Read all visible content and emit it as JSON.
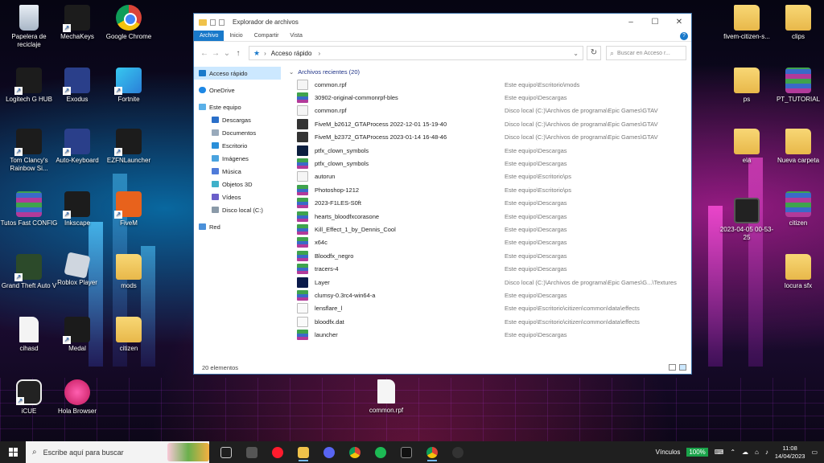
{
  "desktop": {
    "left_icons": [
      {
        "label": "Papelera de reciclaje",
        "icon": "recycle-bin-icon"
      },
      {
        "label": "MechaKeys",
        "icon": "mechakeys-icon"
      },
      {
        "label": "Google Chrome",
        "icon": "chrome-icon"
      },
      {
        "label": "Logitech G HUB",
        "icon": "logitech-icon"
      },
      {
        "label": "Exodus",
        "icon": "exodus-icon"
      },
      {
        "label": "Fortnite",
        "icon": "fortnite-icon"
      },
      {
        "label": "Tom Clancy's Rainbow Si...",
        "icon": "rainbow-six-icon"
      },
      {
        "label": "Auto-Keyboard",
        "icon": "keyboard-icon"
      },
      {
        "label": "EZFNLauncher",
        "icon": "launcher-icon"
      },
      {
        "label": "Tutos Fast CONFIG",
        "icon": "winrar-icon"
      },
      {
        "label": "Inkscape",
        "icon": "inkscape-icon"
      },
      {
        "label": "FiveM",
        "icon": "fivem-icon"
      },
      {
        "label": "Grand Theft Auto V",
        "icon": "gta-icon"
      },
      {
        "label": "Roblox Player",
        "icon": "roblox-icon"
      },
      {
        "label": "mods",
        "icon": "folder-icon"
      },
      {
        "label": "cihasd",
        "icon": "sound-icon"
      },
      {
        "label": "Medal",
        "icon": "medal-icon"
      },
      {
        "label": "citizen",
        "icon": "folder-icon"
      },
      {
        "label": "iCUE",
        "icon": "icue-icon"
      },
      {
        "label": "Hola Browser",
        "icon": "hola-icon"
      }
    ],
    "right_icons": [
      {
        "label": "fivem-citizen-s...",
        "icon": "folder-icon"
      },
      {
        "label": "clips",
        "icon": "folder-icon"
      },
      {
        "label": "ps",
        "icon": "folder-icon"
      },
      {
        "label": "PT_TUTORIAL",
        "icon": "winrar-icon"
      },
      {
        "label": "ela",
        "icon": "folder-icon"
      },
      {
        "label": "Nueva carpeta",
        "icon": "folder-icon"
      },
      {
        "label": "2023-04-05 00-53-25",
        "icon": "video-icon"
      },
      {
        "label": "citizen",
        "icon": "winrar-icon"
      },
      {
        "label": "locura sfx",
        "icon": "folder-icon"
      }
    ],
    "bottom_file": "common.rpf"
  },
  "explorer": {
    "title": "Explorador de archivos",
    "ribbon_tabs": [
      "Archivo",
      "Inicio",
      "Compartir",
      "Vista"
    ],
    "address": "Acceso rápido",
    "search_placeholder": "Buscar en Acceso r...",
    "nav": {
      "quick_access": "Acceso rápido",
      "onedrive": "OneDrive",
      "this_pc": "Este equipo",
      "pc_items": [
        "Descargas",
        "Documentos",
        "Escritorio",
        "Imágenes",
        "Música",
        "Objetos 3D",
        "Vídeos",
        "Disco local (C:)"
      ],
      "network": "Red"
    },
    "group_header": "Archivos recientes (20)",
    "files": [
      {
        "name": "common.rpf",
        "path": "Este equipo\\Escritorio\\mods",
        "type": "file"
      },
      {
        "name": "30902-original-commonrpf-bles",
        "path": "Este equipo\\Descargas",
        "type": "rar"
      },
      {
        "name": "common.rpf",
        "path": "Disco local (C:)\\Archivos de programa\\Epic Games\\GTAV",
        "type": "file"
      },
      {
        "name": "FiveM_b2612_GTAProcess 2022-12-01 15-19-40",
        "path": "Disco local (C:)\\Archivos de programa\\Epic Games\\GTAV",
        "type": "video"
      },
      {
        "name": "FiveM_b2372_GTAProcess 2023-01-14 16-48-46",
        "path": "Disco local (C:)\\Archivos de programa\\Epic Games\\GTAV",
        "type": "video"
      },
      {
        "name": "ptfx_clown_symbols",
        "path": "Este equipo\\Descargas",
        "type": "ps"
      },
      {
        "name": "ptfx_clown_symbols",
        "path": "Este equipo\\Descargas",
        "type": "rar"
      },
      {
        "name": "autorun",
        "path": "Este equipo\\Escritorio\\ps",
        "type": "file"
      },
      {
        "name": "Photoshop-1212",
        "path": "Este equipo\\Escritorio\\ps",
        "type": "rar"
      },
      {
        "name": "2023-F1LES-S0ft",
        "path": "Este equipo\\Descargas",
        "type": "rar"
      },
      {
        "name": "hearts_bloodfxcorasone",
        "path": "Este equipo\\Descargas",
        "type": "rar"
      },
      {
        "name": "Kill_Effect_1_by_Dennis_Cool",
        "path": "Este equipo\\Descargas",
        "type": "rar"
      },
      {
        "name": "x64c",
        "path": "Este equipo\\Descargas",
        "type": "rar"
      },
      {
        "name": "Bloodfx_negro",
        "path": "Este equipo\\Descargas",
        "type": "rar"
      },
      {
        "name": "tracers-4",
        "path": "Este equipo\\Descargas",
        "type": "rar"
      },
      {
        "name": "Layer",
        "path": "Disco local (C:)\\Archivos de programa\\Epic Games\\G...\\Textures",
        "type": "layer"
      },
      {
        "name": "clumsy-0.3rc4-win64-a",
        "path": "Este equipo\\Descargas",
        "type": "rar"
      },
      {
        "name": "lensflare_l",
        "path": "Este equipo\\Escritorio\\citizen\\common\\data\\effects",
        "type": "dat"
      },
      {
        "name": "bloodfx.dat",
        "path": "Este equipo\\Escritorio\\citizen\\common\\data\\effects",
        "type": "dat"
      },
      {
        "name": "launcher",
        "path": "Este equipo\\Descargas",
        "type": "rar"
      }
    ],
    "status": "20 elementos"
  },
  "taskbar": {
    "search_placeholder": "Escribe aquí para buscar",
    "apps": [
      "task-view-icon",
      "app-icon",
      "opera-icon",
      "file-explorer-icon",
      "discord-icon",
      "chrome-icon",
      "spotify-icon",
      "medal-icon",
      "chrome-icon",
      "app-icon"
    ],
    "tray_label": "Vínculos",
    "battery": "100%",
    "time": "11:08",
    "date": "14/04/2023"
  }
}
